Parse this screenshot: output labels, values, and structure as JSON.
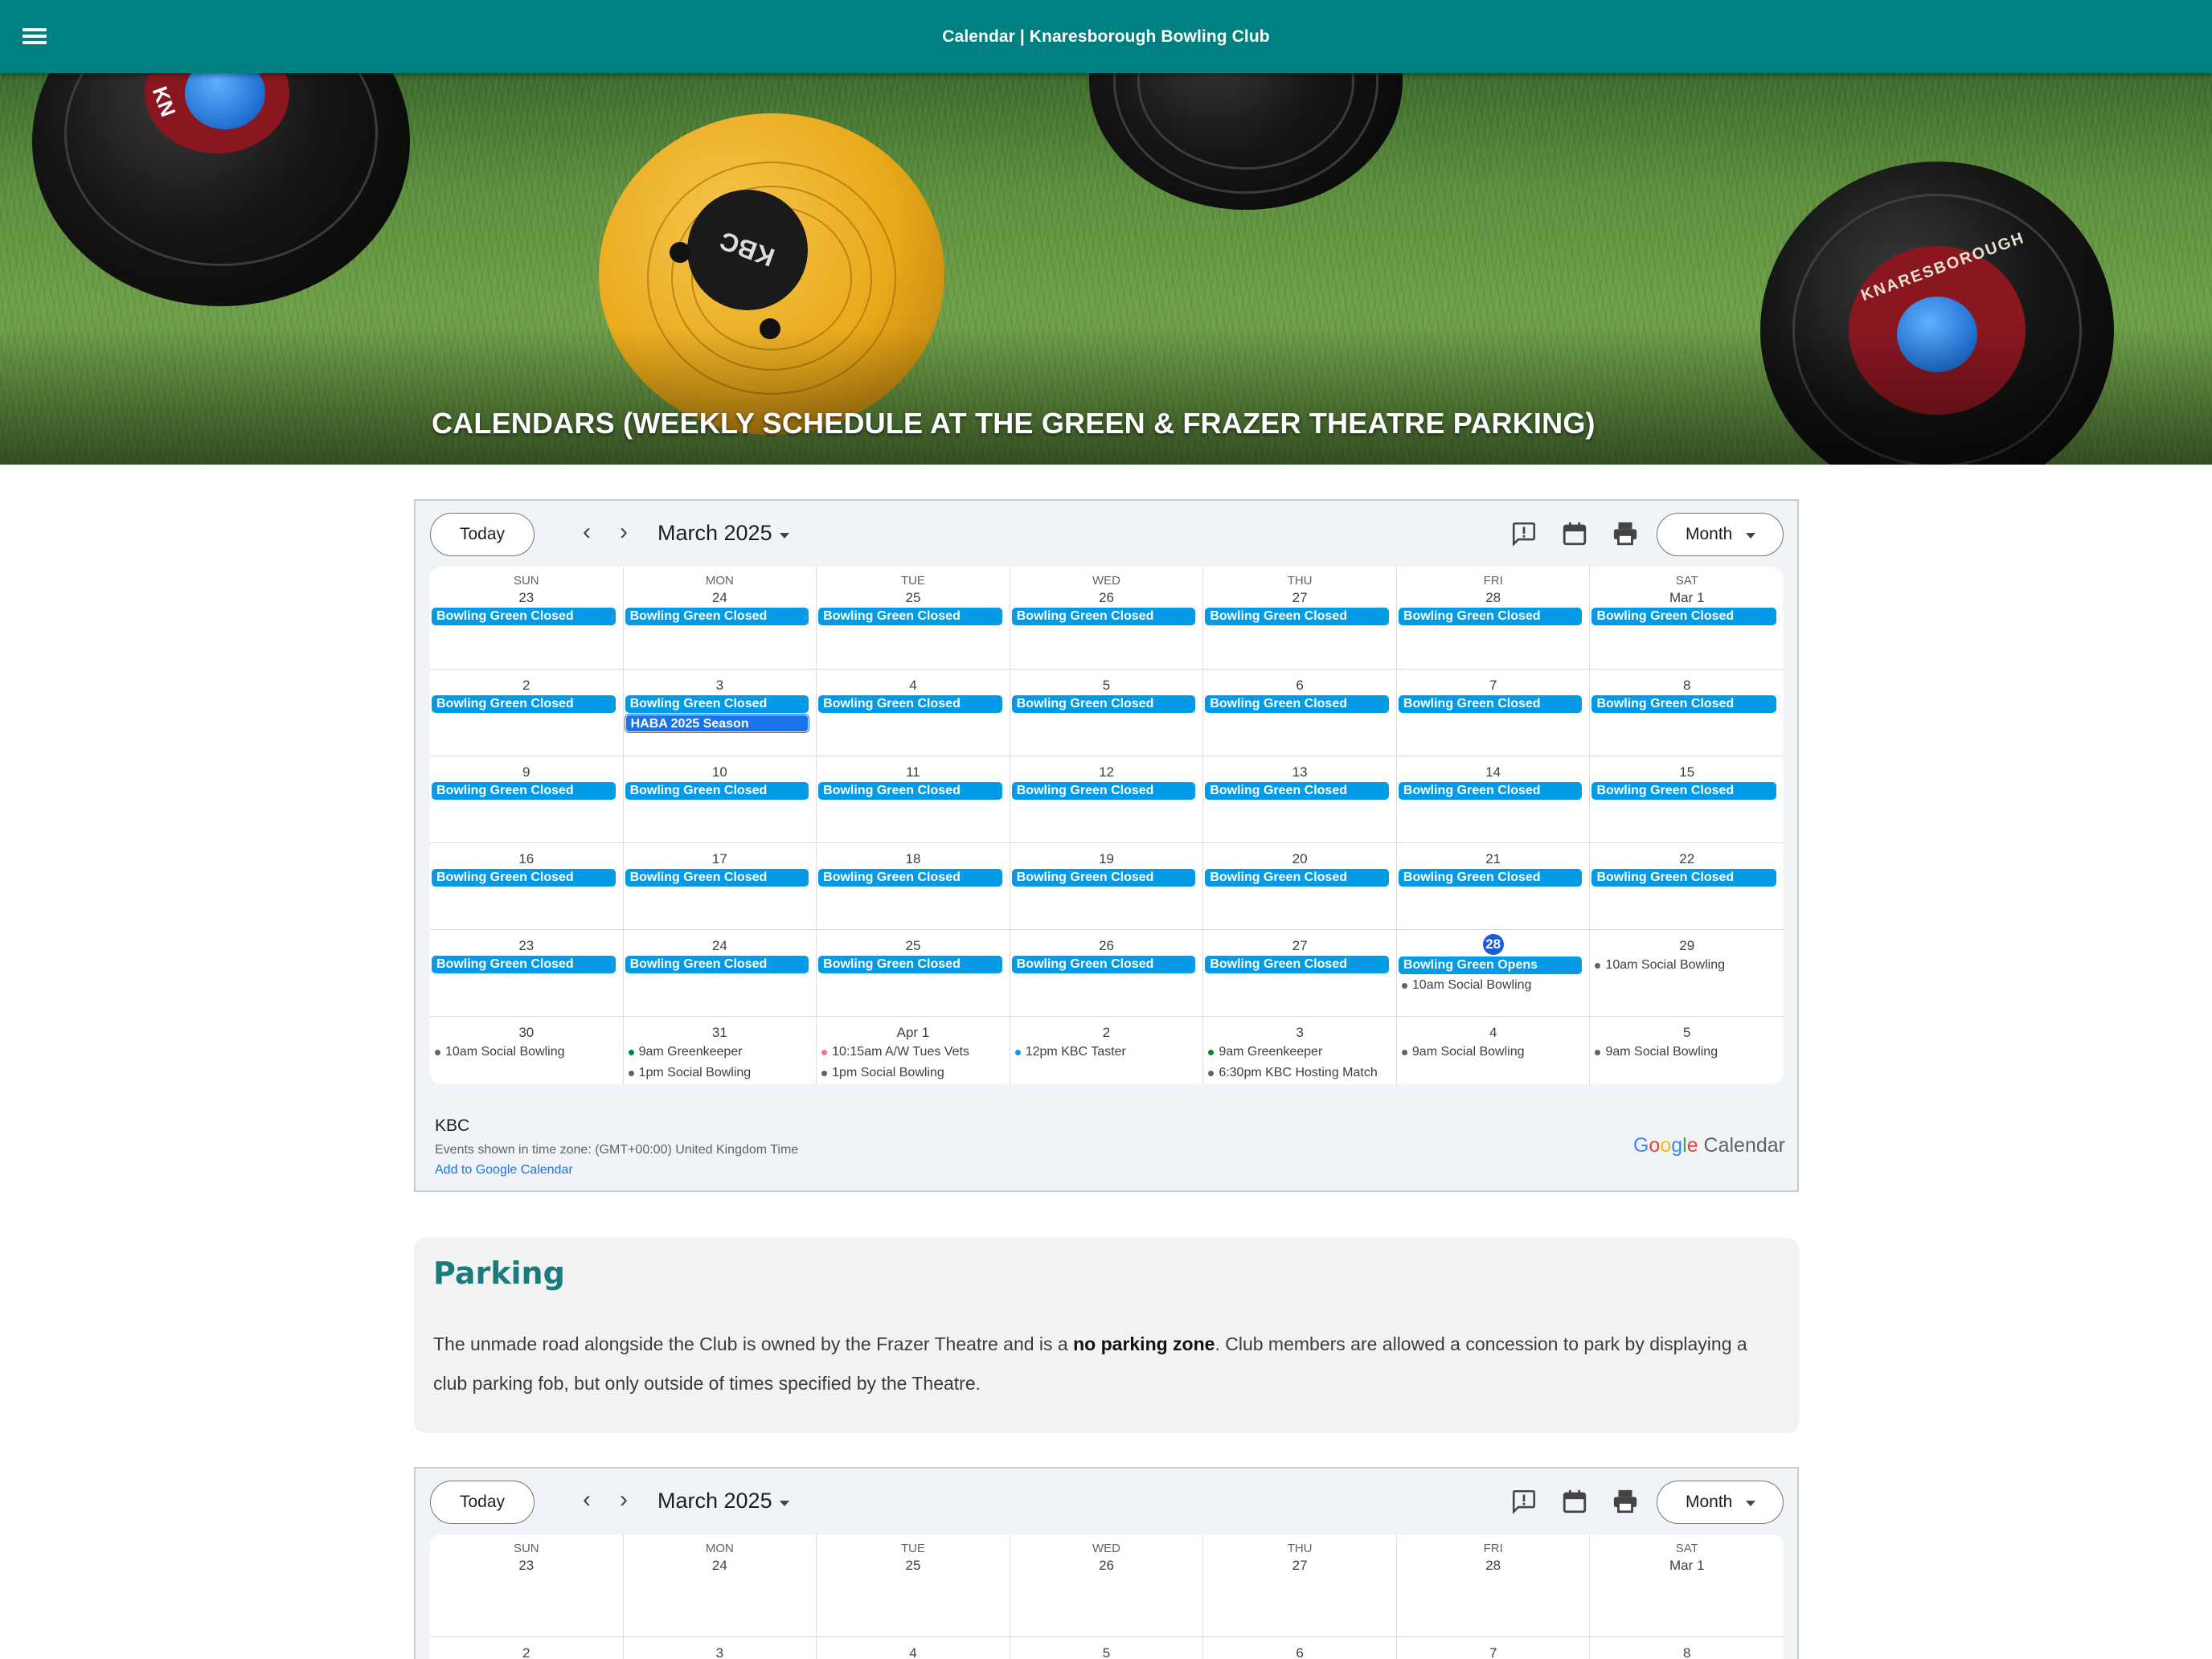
{
  "page": {
    "title": "Calendar | Knaresborough Bowling Club"
  },
  "hero": {
    "heading": "CALENDARS (WEEKLY SCHEDULE AT THE GREEN & FRAZER THEATRE PARKING)",
    "bowl_text_1": "KNARESBOROUGH",
    "bowl_text_2": "KBC",
    "bowl_text_3": "KN"
  },
  "calendar": {
    "today_label": "Today",
    "prev_label": "‹",
    "next_label": "›",
    "month_label": "March 2025",
    "view_label": "Month",
    "icons": [
      "feedback-icon",
      "calendar-icon",
      "print-icon"
    ],
    "weekdays": [
      "SUN",
      "MON",
      "TUE",
      "WED",
      "THU",
      "FRI",
      "SAT"
    ],
    "weeks": [
      {
        "days": [
          {
            "num": "23",
            "events": [
              {
                "type": "bar",
                "text": "Bowling Green Closed"
              }
            ]
          },
          {
            "num": "24",
            "events": [
              {
                "type": "bar",
                "text": "Bowling Green Closed"
              }
            ]
          },
          {
            "num": "25",
            "events": [
              {
                "type": "bar",
                "text": "Bowling Green Closed"
              }
            ]
          },
          {
            "num": "26",
            "events": [
              {
                "type": "bar",
                "text": "Bowling Green Closed"
              }
            ]
          },
          {
            "num": "27",
            "events": [
              {
                "type": "bar",
                "text": "Bowling Green Closed"
              }
            ]
          },
          {
            "num": "28",
            "events": [
              {
                "type": "bar",
                "text": "Bowling Green Closed"
              }
            ]
          },
          {
            "num": "Mar 1",
            "events": [
              {
                "type": "bar",
                "text": "Bowling Green Closed"
              }
            ]
          }
        ]
      },
      {
        "days": [
          {
            "num": "2",
            "events": [
              {
                "type": "bar",
                "text": "Bowling Green Closed"
              }
            ]
          },
          {
            "num": "3",
            "events": [
              {
                "type": "bar",
                "text": "Bowling Green Closed"
              },
              {
                "type": "bar",
                "text": "HABA 2025 Season",
                "alt": true
              }
            ]
          },
          {
            "num": "4",
            "events": [
              {
                "type": "bar",
                "text": "Bowling Green Closed"
              }
            ]
          },
          {
            "num": "5",
            "events": [
              {
                "type": "bar",
                "text": "Bowling Green Closed"
              }
            ]
          },
          {
            "num": "6",
            "events": [
              {
                "type": "bar",
                "text": "Bowling Green Closed"
              }
            ]
          },
          {
            "num": "7",
            "events": [
              {
                "type": "bar",
                "text": "Bowling Green Closed"
              }
            ]
          },
          {
            "num": "8",
            "events": [
              {
                "type": "bar",
                "text": "Bowling Green Closed"
              }
            ]
          }
        ]
      },
      {
        "days": [
          {
            "num": "9",
            "events": [
              {
                "type": "bar",
                "text": "Bowling Green Closed"
              }
            ]
          },
          {
            "num": "10",
            "events": [
              {
                "type": "bar",
                "text": "Bowling Green Closed"
              }
            ]
          },
          {
            "num": "11",
            "events": [
              {
                "type": "bar",
                "text": "Bowling Green Closed"
              }
            ]
          },
          {
            "num": "12",
            "events": [
              {
                "type": "bar",
                "text": "Bowling Green Closed"
              }
            ]
          },
          {
            "num": "13",
            "events": [
              {
                "type": "bar",
                "text": "Bowling Green Closed"
              }
            ]
          },
          {
            "num": "14",
            "events": [
              {
                "type": "bar",
                "text": "Bowling Green Closed"
              }
            ]
          },
          {
            "num": "15",
            "events": [
              {
                "type": "bar",
                "text": "Bowling Green Closed"
              }
            ]
          }
        ]
      },
      {
        "days": [
          {
            "num": "16",
            "events": [
              {
                "type": "bar",
                "text": "Bowling Green Closed"
              }
            ]
          },
          {
            "num": "17",
            "events": [
              {
                "type": "bar",
                "text": "Bowling Green Closed"
              }
            ]
          },
          {
            "num": "18",
            "events": [
              {
                "type": "bar",
                "text": "Bowling Green Closed"
              }
            ]
          },
          {
            "num": "19",
            "events": [
              {
                "type": "bar",
                "text": "Bowling Green Closed"
              }
            ]
          },
          {
            "num": "20",
            "events": [
              {
                "type": "bar",
                "text": "Bowling Green Closed"
              }
            ]
          },
          {
            "num": "21",
            "events": [
              {
                "type": "bar",
                "text": "Bowling Green Closed"
              }
            ]
          },
          {
            "num": "22",
            "events": [
              {
                "type": "bar",
                "text": "Bowling Green Closed"
              }
            ]
          }
        ]
      },
      {
        "days": [
          {
            "num": "23",
            "events": [
              {
                "type": "bar",
                "text": "Bowling Green Closed"
              }
            ]
          },
          {
            "num": "24",
            "events": [
              {
                "type": "bar",
                "text": "Bowling Green Closed"
              }
            ]
          },
          {
            "num": "25",
            "events": [
              {
                "type": "bar",
                "text": "Bowling Green Closed"
              }
            ]
          },
          {
            "num": "26",
            "events": [
              {
                "type": "bar",
                "text": "Bowling Green Closed"
              }
            ]
          },
          {
            "num": "27",
            "events": [
              {
                "type": "bar",
                "text": "Bowling Green Closed"
              }
            ]
          },
          {
            "num": "28",
            "today": true,
            "events": [
              {
                "type": "bar",
                "text": "Bowling Green Opens"
              },
              {
                "type": "dot",
                "text": "10am Social Bowling",
                "color": "#616161"
              }
            ]
          },
          {
            "num": "29",
            "events": [
              {
                "type": "dot",
                "text": "10am Social Bowling",
                "color": "#616161"
              }
            ]
          }
        ]
      },
      {
        "days": [
          {
            "num": "30",
            "events": [
              {
                "type": "dot",
                "text": "10am Social Bowling",
                "color": "#616161"
              }
            ]
          },
          {
            "num": "31",
            "events": [
              {
                "type": "dot",
                "text": "9am Greenkeeper",
                "color": "#0b8043"
              },
              {
                "type": "dot",
                "text": "1pm Social Bowling",
                "color": "#616161"
              }
            ]
          },
          {
            "num": "Apr 1",
            "events": [
              {
                "type": "dot",
                "text": "10:15am A/W Tues Vets",
                "color": "#e67c73"
              },
              {
                "type": "dot",
                "text": "1pm Social Bowling",
                "color": "#616161"
              }
            ]
          },
          {
            "num": "2",
            "events": [
              {
                "type": "dot",
                "text": "12pm KBC Taster",
                "color": "#039be5"
              }
            ]
          },
          {
            "num": "3",
            "events": [
              {
                "type": "dot",
                "text": "9am Greenkeeper",
                "color": "#0b8043"
              },
              {
                "type": "dot",
                "text": "6:30pm KBC Hosting Match",
                "color": "#616161"
              }
            ]
          },
          {
            "num": "4",
            "events": [
              {
                "type": "dot",
                "text": "9am Social Bowling",
                "color": "#616161"
              }
            ]
          },
          {
            "num": "5",
            "events": [
              {
                "type": "dot",
                "text": "9am Social Bowling",
                "color": "#616161"
              }
            ]
          }
        ]
      }
    ],
    "footer": {
      "name": "KBC",
      "timezone": "Events shown in time zone: (GMT+00:00) United Kingdom Time",
      "add_link": "Add to Google Calendar",
      "logo_google": "Google",
      "logo_calendar": "Calendar"
    }
  },
  "calendar2": {
    "today_label": "Today",
    "month_label": "March 2025",
    "view_label": "Month",
    "weeks": [
      {
        "days": [
          {
            "num": "23"
          },
          {
            "num": "24"
          },
          {
            "num": "25"
          },
          {
            "num": "26"
          },
          {
            "num": "27"
          },
          {
            "num": "28"
          },
          {
            "num": "Mar 1"
          }
        ]
      },
      {
        "days": [
          {
            "num": "2"
          },
          {
            "num": "3"
          },
          {
            "num": "4"
          },
          {
            "num": "5"
          },
          {
            "num": "6"
          },
          {
            "num": "7"
          },
          {
            "num": "8"
          }
        ]
      }
    ]
  },
  "parking": {
    "heading": "Parking",
    "text_before": "The unmade road alongside the Club is owned by the Frazer Theatre and is a ",
    "text_bold": "no parking zone",
    "text_after": ". Club members are allowed a concession to park by displaying a club parking fob, but only outside of times specified by the Theatre."
  },
  "colors": {
    "topbar": "#008080",
    "event_bar": "#039be5",
    "heading_teal": "#1b7a7a",
    "today_circle": "#1a5bd6"
  }
}
